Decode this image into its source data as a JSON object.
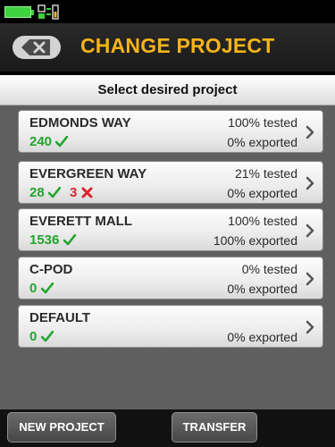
{
  "header": {
    "title": "CHANGE PROJECT"
  },
  "subheader": {
    "text": "Select desired project"
  },
  "projects": [
    {
      "name": "EDMONDS WAY",
      "pass_count": "240",
      "fail_count": "",
      "tested": "100% tested",
      "exported": "0% exported"
    },
    {
      "name": "EVERGREEN WAY",
      "pass_count": "28",
      "fail_count": "3",
      "tested": "21% tested",
      "exported": "0% exported"
    },
    {
      "name": "EVERETT MALL",
      "pass_count": "1536",
      "fail_count": "",
      "tested": "100% tested",
      "exported": "100% exported"
    },
    {
      "name": "C-POD",
      "pass_count": "0",
      "fail_count": "",
      "tested": "0% tested",
      "exported": "0% exported"
    },
    {
      "name": "DEFAULT",
      "pass_count": "0",
      "fail_count": "",
      "tested": "",
      "exported": "0% exported"
    }
  ],
  "footer": {
    "new_project_label": "NEW PROJECT",
    "transfer_label": "TRANSFER"
  },
  "colors": {
    "accent": "#f6b41a",
    "pass": "#21a62c",
    "fail": "#d8262b",
    "battery": "#3fd23f"
  },
  "icons": {
    "back": "back-arrow-icon",
    "battery": "battery-icon",
    "connection": "connection-icon",
    "pass": "check-icon",
    "fail": "cross-icon",
    "row_arrow": "chevron-right-icon"
  }
}
